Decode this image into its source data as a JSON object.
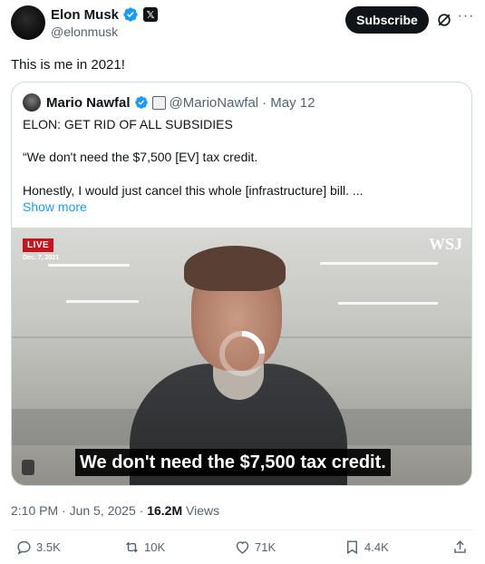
{
  "author": {
    "name": "Elon Musk",
    "handle": "@elonmusk",
    "affiliate_badge": "𝕏"
  },
  "header": {
    "subscribe_label": "Subscribe",
    "more_label": "···"
  },
  "tweet": {
    "text": "This is me in 2021!"
  },
  "quote": {
    "name": "Mario Nawfal",
    "handle": "@MarioNawfal",
    "date": "· May 12",
    "lines": [
      "ELON: GET RID OF ALL SUBSIDIES",
      "“We don't need the $7,500 [EV] tax credit.",
      "Honestly, I would just cancel this whole [infrastructure] bill. ..."
    ],
    "show_more": "Show more",
    "video": {
      "live_label": "LIVE",
      "date_label": "Dec. 7, 2021",
      "wsj_label": "WSJ",
      "caption": "We don't need the $7,500 tax credit."
    }
  },
  "meta": {
    "time": "2:10 PM · Jun 5, 2025 · ",
    "views_count": "16.2M",
    "views_label": " Views"
  },
  "actions": {
    "replies": "3.5K",
    "reposts": "10K",
    "likes": "71K",
    "bookmarks": "4.4K"
  },
  "colors": {
    "accent": "#1d9bf0",
    "text": "#0f1419",
    "muted": "#536471",
    "border": "#cfd9de"
  }
}
